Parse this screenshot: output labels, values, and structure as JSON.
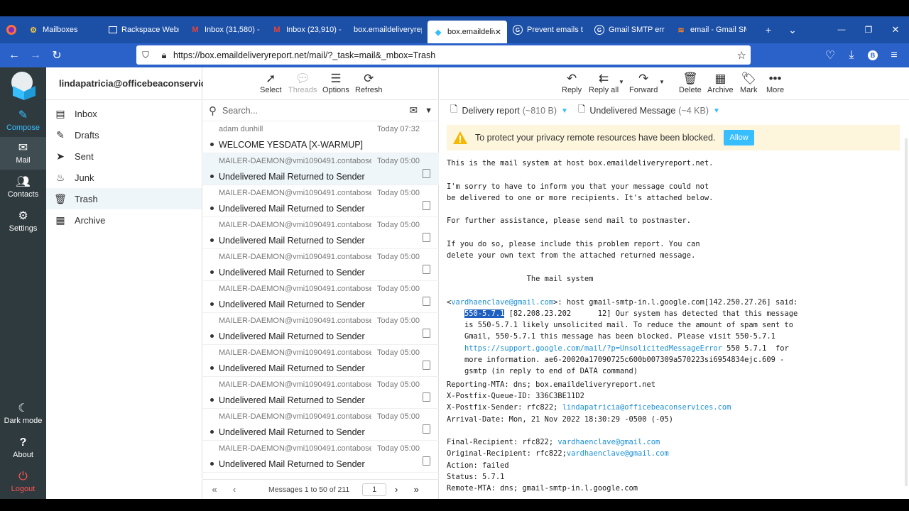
{
  "browser": {
    "tabs": [
      {
        "title": "Mailboxes",
        "icon": "gear-icon"
      },
      {
        "title": "Rackspace Webm",
        "icon": "webmail-icon"
      },
      {
        "title": "Inbox (31,580) - a",
        "icon": "gmail-icon"
      },
      {
        "title": "Inbox (23,910) - o",
        "icon": "gmail-icon"
      },
      {
        "title": "box.emaildeliveryrep",
        "icon": "page-icon"
      },
      {
        "title": "box.emaildeliv",
        "icon": "roundcube-icon",
        "active": true
      },
      {
        "title": "Prevent emails to",
        "icon": "google-icon"
      },
      {
        "title": "Gmail SMTP error",
        "icon": "google-icon"
      },
      {
        "title": "email - Gmail SM",
        "icon": "stackexchange-icon"
      }
    ],
    "url": "https://box.emaildeliveryreport.net/mail/?_task=mail&_mbox=Trash",
    "new_tab": "+",
    "tab_list": "⌄",
    "minimize": "—",
    "maximize": "❐",
    "close": "✕"
  },
  "rail": {
    "items": [
      {
        "label": "Compose",
        "icon": "compose-icon"
      },
      {
        "label": "Mail",
        "icon": "mail-icon"
      },
      {
        "label": "Contacts",
        "icon": "contacts-icon"
      },
      {
        "label": "Settings",
        "icon": "settings-icon"
      },
      {
        "label": "Dark mode",
        "icon": "moon-icon"
      },
      {
        "label": "About",
        "icon": "question-icon"
      },
      {
        "label": "Logout",
        "icon": "power-icon"
      }
    ]
  },
  "account": {
    "email": "lindapatricia@officebeaconservic..."
  },
  "folders": [
    {
      "label": "Inbox",
      "icon": "inbox-icon"
    },
    {
      "label": "Drafts",
      "icon": "drafts-icon"
    },
    {
      "label": "Sent",
      "icon": "sent-icon"
    },
    {
      "label": "Junk",
      "icon": "junk-icon"
    },
    {
      "label": "Trash",
      "icon": "trash-icon",
      "selected": true
    },
    {
      "label": "Archive",
      "icon": "archive-icon"
    }
  ],
  "list_toolbar": {
    "select": "Select",
    "threads": "Threads",
    "options": "Options",
    "refresh": "Refresh"
  },
  "search": {
    "placeholder": "Search..."
  },
  "messages": [
    {
      "from": "adam dunhill",
      "date": "Today 07:32",
      "subject": "WELCOME YESDATA [X-WARMUP]",
      "attachment": false
    },
    {
      "from": "MAILER-DAEMON@vmi1090491.contaboser...",
      "date": "Today 05:00",
      "subject": "Undelivered Mail Returned to Sender",
      "attachment": true,
      "selected": true
    },
    {
      "from": "MAILER-DAEMON@vmi1090491.contaboser...",
      "date": "Today 05:00",
      "subject": "Undelivered Mail Returned to Sender",
      "attachment": true
    },
    {
      "from": "MAILER-DAEMON@vmi1090491.contaboser...",
      "date": "Today 05:00",
      "subject": "Undelivered Mail Returned to Sender",
      "attachment": true
    },
    {
      "from": "MAILER-DAEMON@vmi1090491.contaboser...",
      "date": "Today 05:00",
      "subject": "Undelivered Mail Returned to Sender",
      "attachment": true
    },
    {
      "from": "MAILER-DAEMON@vmi1090491.contaboser...",
      "date": "Today 05:00",
      "subject": "Undelivered Mail Returned to Sender",
      "attachment": true
    },
    {
      "from": "MAILER-DAEMON@vmi1090491.contaboser...",
      "date": "Today 05:00",
      "subject": "Undelivered Mail Returned to Sender",
      "attachment": true
    },
    {
      "from": "MAILER-DAEMON@vmi1090491.contaboser...",
      "date": "Today 05:00",
      "subject": "Undelivered Mail Returned to Sender",
      "attachment": true
    },
    {
      "from": "MAILER-DAEMON@vmi1090491.contaboser...",
      "date": "Today 05:00",
      "subject": "Undelivered Mail Returned to Sender",
      "attachment": true
    },
    {
      "from": "MAILER-DAEMON@vmi1090491.contaboser...",
      "date": "Today 05:00",
      "subject": "Undelivered Mail Returned to Sender",
      "attachment": true
    },
    {
      "from": "MAILER-DAEMON@vmi1090491.contaboser...",
      "date": "Today 05:00",
      "subject": "Undelivered Mail Returned to Sender",
      "attachment": true
    }
  ],
  "pager": {
    "text": "Messages 1 to 50 of 211",
    "page": "1"
  },
  "view_toolbar": {
    "reply": "Reply",
    "reply_all": "Reply all",
    "forward": "Forward",
    "delete": "Delete",
    "archive": "Archive",
    "mark": "Mark",
    "more": "More"
  },
  "parts": {
    "report": "Delivery report",
    "report_size": "(~810 B)",
    "message": "Undelivered Message",
    "message_size": "(~4 KB)"
  },
  "privacy_notice": {
    "text": "To protect your privacy remote resources have been blocked.",
    "allow": "Allow"
  },
  "body": {
    "l1": "This is the mail system at host box.emaildeliveryreport.net.",
    "l2": "I'm sorry to have to inform you that your message could not",
    "l3": "be delivered to one or more recipients. It's attached below.",
    "l4": "For further assistance, please send mail to postmaster.",
    "l5": "If you do so, please include this problem report. You can",
    "l6": "delete your own text from the attached returned message.",
    "l7": "                  The mail system",
    "rcpt_open": "<",
    "rcpt": "vardhaenclave@gmail.com",
    "rcpt_rest": ">: host gmail-smtp-in.l.google.com[142.250.27.26] said:",
    "code": "550-5.7.1",
    "l8_rest": " [82.208.23.202      12] Our system has detected that this message",
    "l9": "    is 550-5.7.1 likely unsolicited mail. To reduce the amount of spam sent to",
    "l10": "    Gmail, 550-5.7.1 this message has been blocked. Please visit 550-5.7.1",
    "link": "https://support.google.com/mail/?p=UnsolicitedMessageError",
    "link_rest": " 550 5.7.1  for",
    "l12": "    more information. ae6-20020a17090725c600b007309a570223si6954834ejc.609 -",
    "l13": "    gsmtp (in reply to end of DATA command)",
    "h1": "Reporting-MTA: dns; box.emaildeliveryreport.net",
    "h2": "X-Postfix-Queue-ID: 336C3BE11D2",
    "h3": "X-Postfix-Sender: rfc822; ",
    "h3_link": "lindapatricia@officebeaconservices.com",
    "h4": "Arrival-Date: Mon, 21 Nov 2022 18:30:29 -0500 (-05)",
    "h5": "Final-Recipient: rfc822; ",
    "h5_link": "vardhaenclave@gmail.com",
    "h6": "Original-Recipient: rfc822;",
    "h6_link": "vardhaenclave@gmail.com",
    "h7": "Action: failed",
    "h8": "Status: 5.7.1",
    "h9": "Remote-MTA: dns; gmail-smtp-in.l.google.com"
  },
  "colors": {
    "tabbar": "#1c4fa6",
    "navbar": "#2a62c9",
    "rail": "#2f3a3f",
    "accent": "#37beff",
    "logout": "#ff5552"
  }
}
